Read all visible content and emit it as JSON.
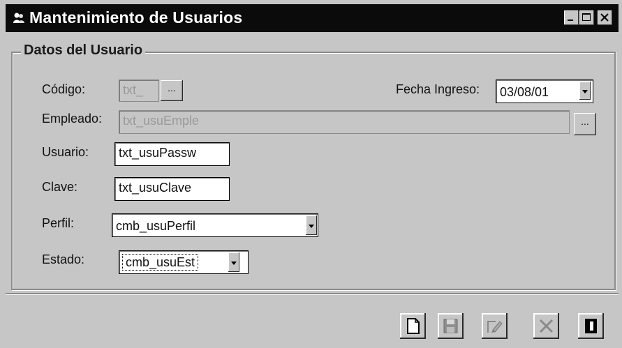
{
  "window": {
    "title": "Mantenimiento de Usuarios"
  },
  "group": {
    "legend": "Datos del Usuario"
  },
  "form": {
    "codigo_label": "Código:",
    "codigo_value": "txt_",
    "codigo_button": "...",
    "fecha_label": "Fecha Ingreso:",
    "fecha_value": "03/08/01",
    "empleado_label": "Empleado:",
    "empleado_value": "txt_usuEmple",
    "empleado_button": "...",
    "usuario_label": "Usuario:",
    "usuario_value": "txt_usuPassw",
    "clave_label": "Clave:",
    "clave_value": "txt_usuClave",
    "perfil_label": "Perfil:",
    "perfil_value": "cmb_usuPerfil",
    "estado_label": "Estado:",
    "estado_value": "cmb_usuEst"
  },
  "toolbar": {
    "icons": [
      "new-document-icon",
      "save-icon",
      "edit-icon",
      "delete-icon",
      "exit-icon"
    ]
  }
}
